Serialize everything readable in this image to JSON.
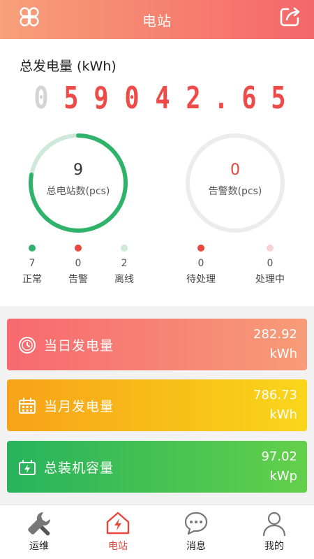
{
  "header": {
    "title": "电站",
    "menu_icon": "clover-menu-icon",
    "share_icon": "share-icon"
  },
  "total_energy": {
    "label": "总发电量 (kWh)",
    "digits": [
      "0",
      "5",
      "9",
      "0",
      "4",
      "2",
      ".",
      "6",
      "5"
    ],
    "dim_digits": 1
  },
  "stations": {
    "count": "9",
    "label": "总电站数(pcs)",
    "ring_fraction": 0.778,
    "ring_color": "#2fb36b",
    "ring_rest_color": "#cfe8da",
    "legend": [
      {
        "value": "7",
        "label": "正常",
        "color": "#2fb36b"
      },
      {
        "value": "0",
        "label": "告警",
        "color": "#e8453c"
      },
      {
        "value": "2",
        "label": "离线",
        "color": "#cfe8da"
      }
    ]
  },
  "alarms": {
    "count": "0",
    "label": "告警数(pcs)",
    "ring_color": "#ececec",
    "count_color": "#e8453c",
    "legend": [
      {
        "value": "0",
        "label": "待处理",
        "color": "#e8453c"
      },
      {
        "value": "0",
        "label": "处理中",
        "color": "#f7d3d6"
      }
    ]
  },
  "stats": [
    {
      "title": "当日发电量",
      "value": "282.92",
      "unit": "kWh",
      "icon": "clock-icon"
    },
    {
      "title": "当月发电量",
      "value": "786.73",
      "unit": "kWh",
      "icon": "calendar-icon"
    },
    {
      "title": "总装机容量",
      "value": "97.02",
      "unit": "kWp",
      "icon": "battery-icon"
    }
  ],
  "tabs": [
    {
      "label": "运维",
      "icon": "wrench-icon"
    },
    {
      "label": "电站",
      "icon": "station-home-icon",
      "active": true
    },
    {
      "label": "消息",
      "icon": "message-icon"
    },
    {
      "label": "我的",
      "icon": "user-icon"
    }
  ],
  "colors": {
    "accent": "#e8453c",
    "daily_gradient": [
      "#f7696f",
      "#f79c78"
    ],
    "monthly_gradient": [
      "#f8a218",
      "#f9d61b"
    ],
    "capacity_gradient": [
      "#27b35c",
      "#63d04a"
    ]
  }
}
